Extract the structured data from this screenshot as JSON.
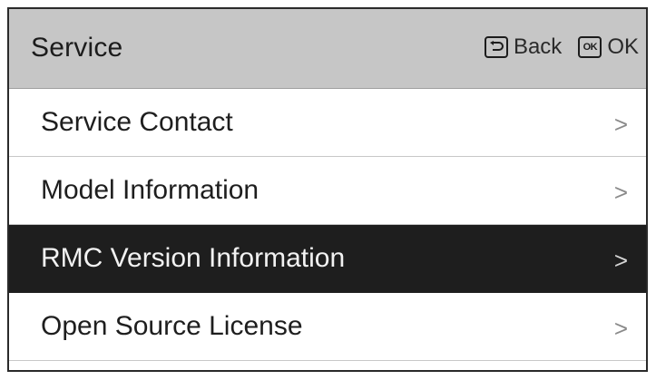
{
  "header": {
    "title": "Service",
    "back_label": "Back",
    "ok_key_label": "OK",
    "ok_label": "OK"
  },
  "menu": {
    "items": [
      {
        "label": "Service Contact",
        "chevron": ">",
        "selected": false
      },
      {
        "label": "Model Information",
        "chevron": ">",
        "selected": false
      },
      {
        "label": "RMC Version Information",
        "chevron": ">",
        "selected": true
      },
      {
        "label": "Open Source License",
        "chevron": ">",
        "selected": false
      }
    ]
  },
  "icons": {
    "back": "back-arrow-icon",
    "ok": "ok-key-icon",
    "chevron": "chevron-right-icon"
  },
  "colors": {
    "header_bg": "#c6c6c6",
    "selected_bg": "#1e1e1e",
    "selected_text": "#f2f2f2",
    "text": "#1e1e1e"
  }
}
